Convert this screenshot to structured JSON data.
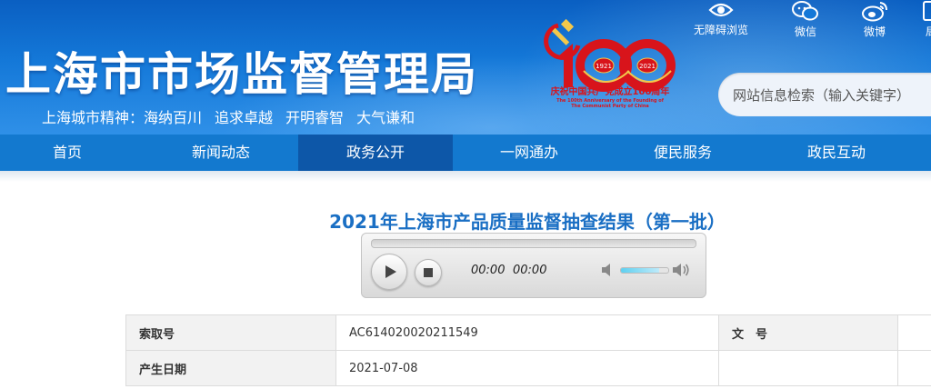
{
  "header": {
    "title": "上海市市场监督管理局",
    "spirit_label": "上海城市精神：",
    "spirit_items": [
      "海纳百川",
      "追求卓越",
      "开明睿智",
      "大气谦和"
    ]
  },
  "logo": {
    "number": "100",
    "year_left": "1921",
    "year_right": "2021",
    "caption_cn": "庆祝中国共产党成立100周年",
    "caption_en_1": "The 100th Anniversary of the Founding of",
    "caption_en_2": "The Communist Party of China",
    "colors": {
      "red": "#d8141b",
      "gold": "#f3c84b"
    }
  },
  "tools": [
    {
      "label": "无障碍浏览",
      "icon": "eye-icon"
    },
    {
      "label": "微信",
      "icon": "wechat-icon"
    },
    {
      "label": "微博",
      "icon": "weibo-icon"
    },
    {
      "label": "局",
      "icon": "phone-icon"
    }
  ],
  "search": {
    "placeholder": "网站信息检索（输入关键字）"
  },
  "nav": {
    "items": [
      "首页",
      "新闻动态",
      "政务公开",
      "一网通办",
      "便民服务",
      "政民互动"
    ],
    "active_index": 2,
    "colors": {
      "bar": "#1379cf",
      "active": "#0d57a8"
    }
  },
  "article": {
    "title": "2021年上海市产品质量监督抽查结果（第一批）"
  },
  "player": {
    "current_time": "00:00",
    "total_time": "00:00",
    "volume": 0.8
  },
  "info_table": {
    "rows": [
      {
        "k1": "索取号",
        "v1": "AC614020020211549",
        "k2": "文　号",
        "v2": ""
      },
      {
        "k1": "产生日期",
        "v1": "2021-07-08",
        "k2": "",
        "v2": ""
      }
    ]
  }
}
